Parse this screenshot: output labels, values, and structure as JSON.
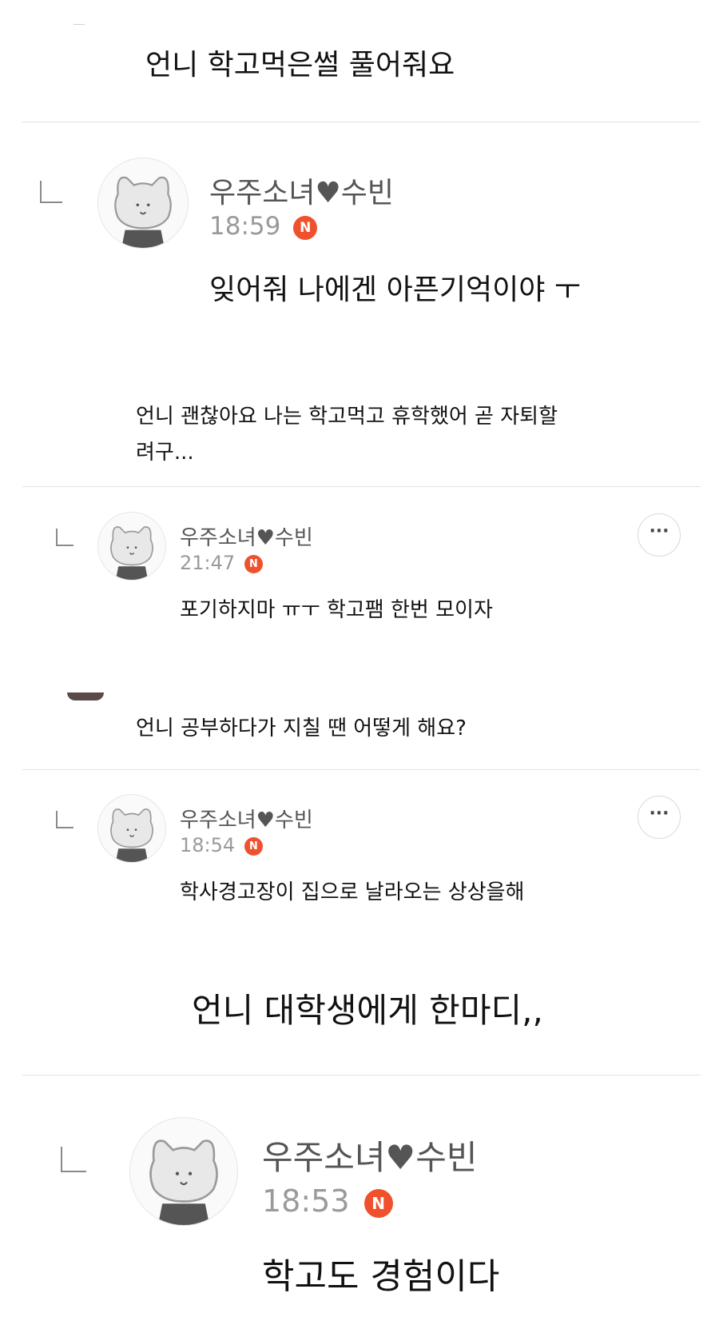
{
  "comment1": {
    "question": "언니 학고먹은썰 풀어줘요",
    "reply": {
      "name": "우주소녀♥수빈",
      "time": "18:59",
      "badge": "N",
      "text": "잊어줘 나에겐 아픈기억이야 ㅜ"
    }
  },
  "comment2": {
    "question_line1": "언니 괜찮아요 나는 학고먹고 휴학했어 곧 자퇴할",
    "question_line2": "려구...",
    "reply": {
      "name": "우주소녀♥수빈",
      "time": "21:47",
      "badge": "N",
      "text": "포기하지마 ㅠㅜ 학고팸 한번 모이자",
      "more": "···"
    }
  },
  "comment3": {
    "question": "언니 공부하다가 지칠 땐 어떻게 해요?",
    "reply": {
      "name": "우주소녀♥수빈",
      "time": "18:54",
      "badge": "N",
      "text": "학사경고장이 집으로 날라오는 상상을해",
      "more": "···"
    }
  },
  "comment4": {
    "question": "언니 대학생에게 한마디,,",
    "reply": {
      "name": "우주소녀♥수빈",
      "time": "18:53",
      "badge": "N",
      "text": "학고도 경험이다"
    }
  },
  "colors": {
    "badge": "#f0512d",
    "divider": "#e3e3e3",
    "name": "#555555",
    "time": "#9a9a9a"
  },
  "icons": {
    "reply": "reply-arrow-icon",
    "more": "more-dots-icon",
    "new": "new-badge-icon",
    "avatar": "cat-avatar-icon"
  }
}
